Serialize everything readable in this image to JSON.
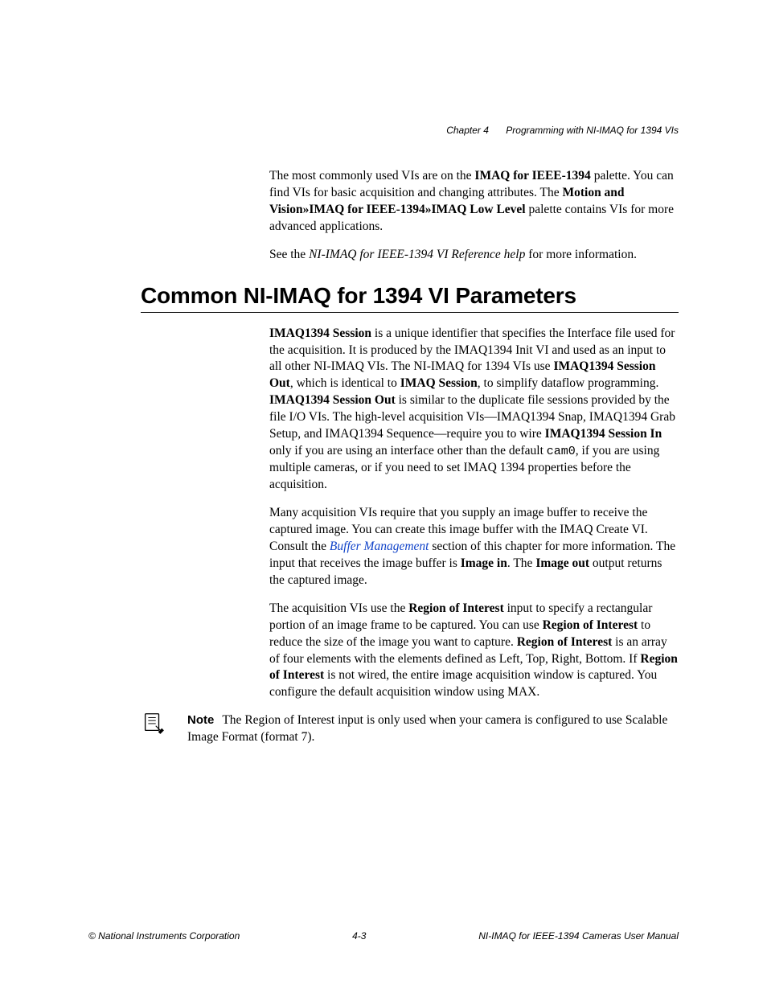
{
  "header": {
    "chapter": "Chapter 4",
    "title": "Programming with NI-IMAQ for 1394 VIs"
  },
  "intro": {
    "p1_a": "The most commonly used VIs are on the ",
    "p1_bold1": "IMAQ for IEEE-1394",
    "p1_b": " palette. You can find VIs for basic acquisition and changing attributes. The ",
    "p1_bold2": "Motion and Vision»IMAQ for IEEE-1394»IMAQ Low Level",
    "p1_c": " palette contains VIs for more advanced applications.",
    "p2_a": "See the ",
    "p2_i": "NI-IMAQ for IEEE-1394 VI Reference help",
    "p2_b": " for more information."
  },
  "section_title": "Common NI-IMAQ for 1394 VI Parameters",
  "para1": {
    "b1": "IMAQ1394 Session",
    "t1": " is a unique identifier that specifies the Interface file used for the acquisition. It is produced by the IMAQ1394 Init VI and used as an input to all other NI-IMAQ VIs. The NI-IMAQ for 1394 VIs use ",
    "b2": "IMAQ1394 Session Out",
    "t2": ", which is identical to ",
    "b3": "IMAQ Session",
    "t3": ", to simplify dataflow programming. ",
    "b4": "IMAQ1394 Session Out",
    "t4": " is similar to the duplicate file sessions provided by the file I/O VIs. The high-level acquisition VIs—IMAQ1394 Snap, IMAQ1394 Grab Setup, and IMAQ1394 Sequence—require you to wire ",
    "b5": "IMAQ1394 Session In",
    "t5": " only if you are using an interface other than the default ",
    "code": "cam0",
    "t6": ", if you are using multiple cameras, or if you need to set IMAQ 1394 properties before the acquisition."
  },
  "para2": {
    "t1": "Many acquisition VIs require that you supply an image buffer to receive the captured image. You can create this image buffer with the IMAQ Create VI. Consult the ",
    "link": "Buffer Management",
    "t2": " section of this chapter for more information. The input that receives the image buffer is ",
    "b1": "Image in",
    "t3": ". The ",
    "b2": "Image out",
    "t4": " output returns the captured image."
  },
  "para3": {
    "t1": "The acquisition VIs use the ",
    "b1": "Region of Interest",
    "t2": " input to specify a rectangular portion of an image frame to be captured. You can use ",
    "b2": "Region of Interest",
    "t3": " to reduce the size of the image you want to capture. ",
    "b3": "Region of Interest",
    "t4": " is an array of four elements with the elements defined as Left, Top, Right, Bottom. If ",
    "b4": "Region of Interest",
    "t5": " is not wired, the entire image acquisition window is captured. You configure the default acquisition window using MAX."
  },
  "note": {
    "label": "Note",
    "text": "The Region of Interest input is only used when your camera is configured to use Scalable Image Format (format 7)."
  },
  "footer": {
    "left": "© National Instruments Corporation",
    "center": "4-3",
    "right": "NI-IMAQ for IEEE-1394 Cameras User Manual"
  }
}
